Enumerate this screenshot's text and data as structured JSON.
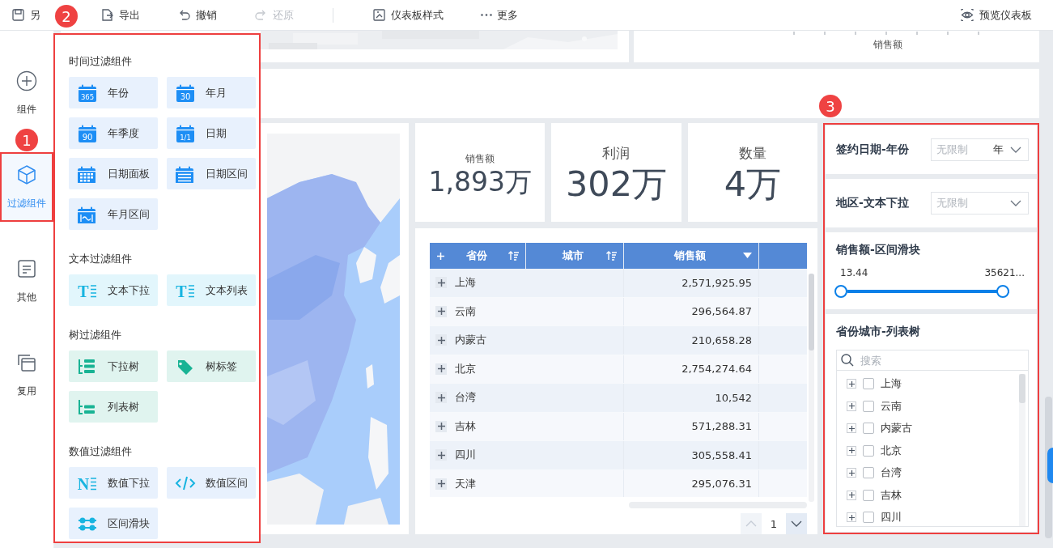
{
  "toolbar": {
    "items": [
      {
        "label": "另",
        "disabled": false
      },
      {
        "label": "导出",
        "disabled": false
      },
      {
        "label": "撤销",
        "disabled": false
      },
      {
        "label": "还原",
        "disabled": true,
        "separator_after": true
      },
      {
        "label": "仪表板样式",
        "disabled": false
      },
      {
        "label": "更多",
        "disabled": false
      }
    ],
    "preview": {
      "label": "预览仪表板"
    }
  },
  "sidebar": {
    "callout": "1",
    "items": [
      {
        "label": "组件",
        "selected": false
      },
      {
        "label": "过滤组件",
        "selected": true
      },
      {
        "label": "其他",
        "selected": false
      },
      {
        "label": "复用",
        "selected": false
      }
    ]
  },
  "flyout": {
    "callout": "2",
    "sections": [
      {
        "title": "时间过滤组件",
        "kind": "time",
        "tiles": [
          {
            "label": "年份",
            "icon_text": "365"
          },
          {
            "label": "年月",
            "icon_text": "30"
          },
          {
            "label": "年季度",
            "icon_text": "90"
          },
          {
            "label": "日期",
            "icon_text": "1/1"
          },
          {
            "label": "日期面板"
          },
          {
            "label": "日期区间"
          },
          {
            "label": "年月区间"
          }
        ]
      },
      {
        "title": "文本过滤组件",
        "kind": "text",
        "tiles": [
          {
            "label": "文本下拉",
            "icon_text": "T"
          },
          {
            "label": "文本列表",
            "icon_text": "T"
          }
        ]
      },
      {
        "title": "树过滤组件",
        "kind": "tree",
        "tiles": [
          {
            "label": "下拉树"
          },
          {
            "label": "树标签"
          },
          {
            "label": "列表树"
          }
        ]
      },
      {
        "title": "数值过滤组件",
        "kind": "number",
        "tiles": [
          {
            "label": "数值下拉",
            "icon_text": "N"
          },
          {
            "label": "数值区间"
          },
          {
            "label": "区间滑块"
          }
        ]
      }
    ]
  },
  "dashboard": {
    "axis_label": "销售额",
    "kpis": [
      {
        "title": "销售额",
        "value": "1,893万"
      },
      {
        "title": "利润",
        "value": "302万"
      },
      {
        "title": "数量",
        "value": "4万"
      }
    ],
    "table": {
      "columns": [
        {
          "label": "省份",
          "kind": "sort",
          "expandable": true
        },
        {
          "label": "城市",
          "kind": "sort",
          "expandable": false
        },
        {
          "label": "销售额",
          "kind": "menu",
          "expandable": false
        }
      ],
      "rows": [
        {
          "province": "上海",
          "sales": "2,571,925.95",
          "expanded": false
        },
        {
          "province": "云南",
          "sales": "296,564.87",
          "expanded": false
        },
        {
          "province": "内蒙古",
          "sales": "210,658.28",
          "expanded": false
        },
        {
          "province": "北京",
          "sales": "2,754,274.64",
          "expanded": false
        },
        {
          "province": "台湾",
          "sales": "10,542",
          "expanded": false
        },
        {
          "province": "吉林",
          "sales": "571,288.31",
          "expanded": false
        },
        {
          "province": "四川",
          "sales": "305,558.41",
          "expanded": false
        },
        {
          "province": "天津",
          "sales": "295,076.31",
          "expanded": false
        }
      ],
      "pagination": {
        "page": "1",
        "prev_disabled": true,
        "next_disabled": false
      }
    },
    "filters": {
      "callout": "3",
      "panels": [
        {
          "kind": "select",
          "title": "签约日期-年份",
          "placeholder": "无限制",
          "unit": "年"
        },
        {
          "kind": "select",
          "title": "地区-文本下拉",
          "placeholder": "无限制"
        },
        {
          "kind": "range",
          "title": "销售额-区间滑块",
          "min": "13.44",
          "max": "35621...",
          "level": 1
        },
        {
          "kind": "tree",
          "title": "省份城市-列表树",
          "placeholder": "搜索",
          "items": [
            {
              "label": "上海",
              "checked": false,
              "expanded": false
            },
            {
              "label": "云南",
              "checked": false,
              "expanded": false
            },
            {
              "label": "内蒙古",
              "checked": false,
              "expanded": false
            },
            {
              "label": "北京",
              "checked": false,
              "expanded": false
            },
            {
              "label": "台湾",
              "checked": false,
              "expanded": false
            },
            {
              "label": "吉林",
              "checked": false,
              "expanded": false
            },
            {
              "label": "四川",
              "checked": false,
              "expanded": false
            }
          ]
        }
      ]
    }
  }
}
